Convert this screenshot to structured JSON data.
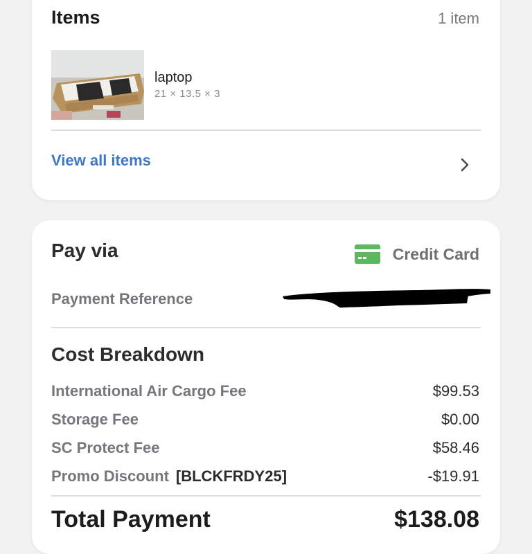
{
  "items_card": {
    "title": "Items",
    "count": "1 item",
    "item": {
      "name": "laptop",
      "dimensions": "21 × 13.5 × 3"
    },
    "view_all": "View all items"
  },
  "pay_card": {
    "title": "Pay via",
    "method": "Credit Card",
    "method_color": "#5cb85c",
    "reference_label": "Payment Reference",
    "cost_title": "Cost Breakdown",
    "rows": [
      {
        "label": "International Air Cargo Fee",
        "value": "$99.53"
      },
      {
        "label": "Storage Fee",
        "value": "$0.00"
      },
      {
        "label": "SC Protect Fee",
        "value": "$58.46"
      },
      {
        "label": "Promo Discount",
        "code": "[BLCKFRDY25]",
        "value": "-$19.91"
      }
    ],
    "total_label": "Total Payment",
    "total_value": "$138.08"
  },
  "colors": {
    "link": "#3d78c8",
    "background": "#f2f2f3",
    "card": "#ffffff"
  }
}
